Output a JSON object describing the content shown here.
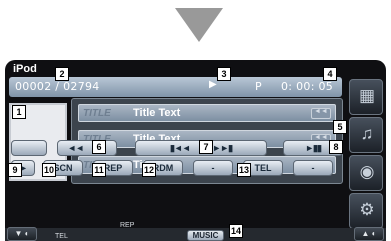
{
  "app": {
    "title": "iPod"
  },
  "info": {
    "track_counter": "00002 / 02794",
    "play_state_icon": "play-triangle",
    "mode": "P",
    "time": "0: 00: 05"
  },
  "tracks": [
    {
      "tag": "TITLE",
      "text": "Title Text"
    },
    {
      "tag": "TITLE",
      "text": "Title Text"
    },
    {
      "tag": "TITLE",
      "text": "Title Text"
    }
  ],
  "controls": {
    "scan": "SCN",
    "repeat": "REP",
    "random": "RDM",
    "blank_minus": "-",
    "tel": "TEL",
    "blank_minus_2": "-",
    "music": "MUSIC",
    "rewind_glyph": "◄◄",
    "ffwd_glyph": "►►",
    "prev_glyph": "▮◄◄",
    "next_glyph": "►►▮",
    "play_pause_glyph": "►▮▮",
    "more_glyph": "►"
  },
  "bottom": {
    "rep_label": "REP",
    "tel_label": "TEL",
    "left_corner": "▼ ◐",
    "right_corner": "▲ ◐"
  },
  "callouts": [
    "1",
    "2",
    "3",
    "4",
    "5",
    "6",
    "7",
    "8",
    "9",
    "10",
    "11",
    "12",
    "13",
    "14"
  ],
  "colors": {
    "device_bg": "#0f0f12",
    "info_bar": "#8094a8",
    "button_face": "#c3ccd6",
    "arrow": "#999999"
  }
}
